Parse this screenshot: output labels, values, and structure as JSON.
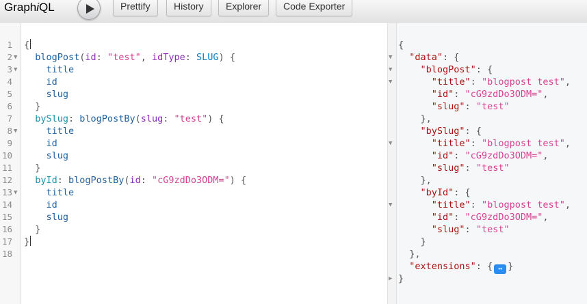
{
  "app": {
    "logo_main": "Graph",
    "logo_italic": "i",
    "logo_tail": "QL"
  },
  "toolbar": {
    "execute_icon": "play-icon",
    "buttons": [
      "Prettify",
      "History",
      "Explorer",
      "Code Exporter"
    ]
  },
  "query_lines": [
    [
      [
        "p",
        "{"
      ]
    ],
    [
      [
        "f",
        "  blogPost"
      ],
      [
        "p",
        "("
      ],
      [
        "a",
        "id"
      ],
      [
        "p",
        ": "
      ],
      [
        "s",
        "\"test\""
      ],
      [
        "p",
        ", "
      ],
      [
        "a",
        "idType"
      ],
      [
        "p",
        ": "
      ],
      [
        "e",
        "SLUG"
      ],
      [
        "p",
        ") {"
      ]
    ],
    [
      [
        "f",
        "    title"
      ]
    ],
    [
      [
        "f",
        "    id"
      ]
    ],
    [
      [
        "f",
        "    slug"
      ]
    ],
    [
      [
        "p",
        "  }"
      ]
    ],
    [
      [
        "al",
        "  bySlug"
      ],
      [
        "p",
        ": "
      ],
      [
        "f",
        "blogPostBy"
      ],
      [
        "p",
        "("
      ],
      [
        "a",
        "slug"
      ],
      [
        "p",
        ": "
      ],
      [
        "s",
        "\"test\""
      ],
      [
        "p",
        ") {"
      ]
    ],
    [
      [
        "f",
        "    title"
      ]
    ],
    [
      [
        "f",
        "    id"
      ]
    ],
    [
      [
        "f",
        "    slug"
      ]
    ],
    [
      [
        "p",
        "  }"
      ]
    ],
    [
      [
        "al",
        "  byId"
      ],
      [
        "p",
        ": "
      ],
      [
        "f",
        "blogPostBy"
      ],
      [
        "p",
        "("
      ],
      [
        "a",
        "id"
      ],
      [
        "p",
        ": "
      ],
      [
        "s",
        "\"cG9zdDo3ODM=\""
      ],
      [
        "p",
        ") {"
      ]
    ],
    [
      [
        "f",
        "    title"
      ]
    ],
    [
      [
        "f",
        "    id"
      ]
    ],
    [
      [
        "f",
        "    slug"
      ]
    ],
    [
      [
        "p",
        "  }"
      ]
    ],
    [
      [
        "p",
        "}"
      ]
    ],
    []
  ],
  "query_folds": [
    1,
    2,
    7,
    12
  ],
  "result_lines": [
    [
      [
        "p",
        "{"
      ]
    ],
    [
      [
        "k",
        "  \"data\""
      ],
      [
        "p",
        ": {"
      ]
    ],
    [
      [
        "k",
        "    \"blogPost\""
      ],
      [
        "p",
        ": {"
      ]
    ],
    [
      [
        "k",
        "      \"title\""
      ],
      [
        "p",
        ": "
      ],
      [
        "v",
        "\"blogpost test\""
      ],
      [
        "p",
        ","
      ]
    ],
    [
      [
        "k",
        "      \"id\""
      ],
      [
        "p",
        ": "
      ],
      [
        "v",
        "\"cG9zdDo3ODM=\""
      ],
      [
        "p",
        ","
      ]
    ],
    [
      [
        "k",
        "      \"slug\""
      ],
      [
        "p",
        ": "
      ],
      [
        "v",
        "\"test\""
      ]
    ],
    [
      [
        "p",
        "    },"
      ]
    ],
    [
      [
        "k",
        "    \"bySlug\""
      ],
      [
        "p",
        ": {"
      ]
    ],
    [
      [
        "k",
        "      \"title\""
      ],
      [
        "p",
        ": "
      ],
      [
        "v",
        "\"blogpost test\""
      ],
      [
        "p",
        ","
      ]
    ],
    [
      [
        "k",
        "      \"id\""
      ],
      [
        "p",
        ": "
      ],
      [
        "v",
        "\"cG9zdDo3ODM=\""
      ],
      [
        "p",
        ","
      ]
    ],
    [
      [
        "k",
        "      \"slug\""
      ],
      [
        "p",
        ": "
      ],
      [
        "v",
        "\"test\""
      ]
    ],
    [
      [
        "p",
        "    },"
      ]
    ],
    [
      [
        "k",
        "    \"byId\""
      ],
      [
        "p",
        ": {"
      ]
    ],
    [
      [
        "k",
        "      \"title\""
      ],
      [
        "p",
        ": "
      ],
      [
        "v",
        "\"blogpost test\""
      ],
      [
        "p",
        ","
      ]
    ],
    [
      [
        "k",
        "      \"id\""
      ],
      [
        "p",
        ": "
      ],
      [
        "v",
        "\"cG9zdDo3ODM=\""
      ],
      [
        "p",
        ","
      ]
    ],
    [
      [
        "k",
        "      \"slug\""
      ],
      [
        "p",
        ": "
      ],
      [
        "v",
        "\"test\""
      ]
    ],
    [
      [
        "p",
        "    }"
      ]
    ],
    [
      [
        "p",
        "  },"
      ]
    ],
    [
      [
        "k",
        "  \"extensions\""
      ],
      [
        "p",
        ": {"
      ],
      [
        "x",
        "↔"
      ],
      [
        "p",
        "}"
      ]
    ],
    [
      [
        "p",
        "}"
      ]
    ]
  ],
  "result_folds_down": [
    1,
    2,
    3,
    8,
    13
  ],
  "result_folds_right": [
    19
  ]
}
